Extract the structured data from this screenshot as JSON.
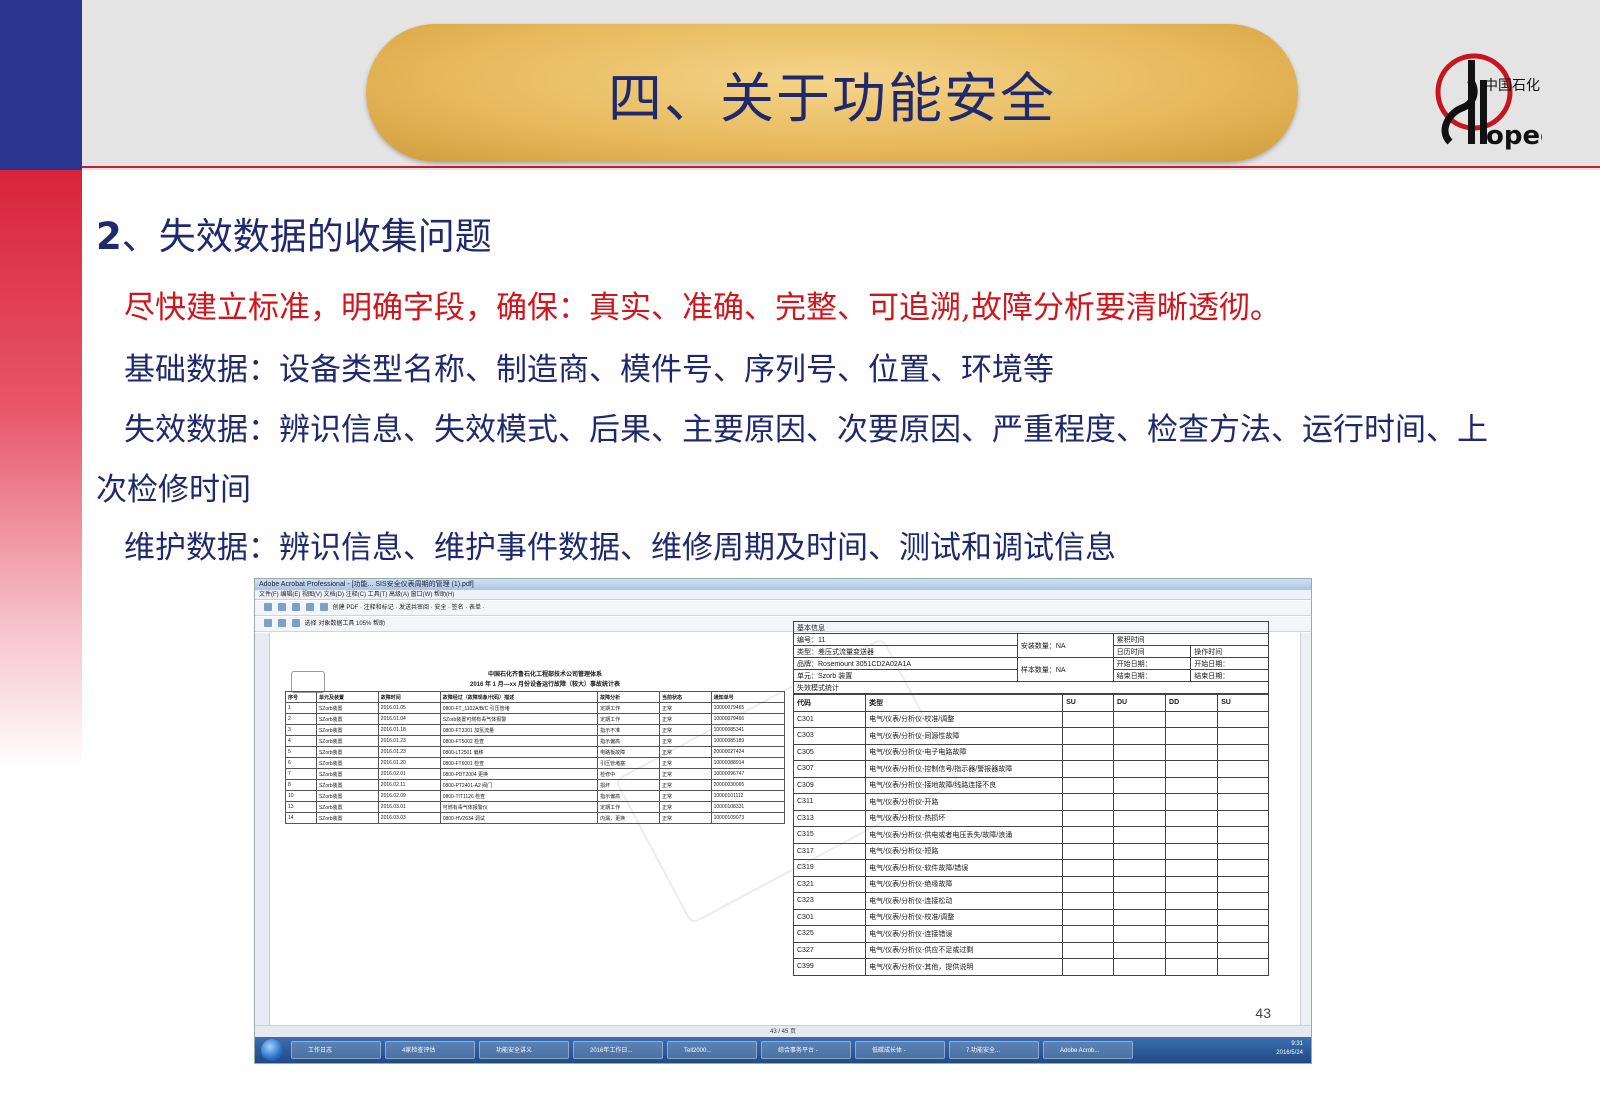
{
  "slide": {
    "title": "四、关于功能安全",
    "section_number": "2",
    "section_title": "、失效数据的收集问题",
    "requirement": "尽快建立标准，明确字段，确保：真实、准确、完整、可追溯,故障分析要清晰透彻。",
    "basic_data": "基础数据：设备类型名称、制造商、模件号、序列号、位置、环境等",
    "failure_data_line1": "失效数据：辨识信息、失效模式、后果、主要原因、次要原因、严重程度、检查方法、运行时间、上",
    "failure_data_line2": "次检修时间",
    "maintenance_data": "维护数据：辨识信息、维护事件数据、维修周期及时间、测试和调试信息",
    "colors": {
      "navy": "#2b3690",
      "red": "#d8243a",
      "gold": "#e6b85a",
      "text_blue": "#1f2a6e",
      "text_red": "#d0161c"
    }
  },
  "logo": {
    "brand": "SINOPEC",
    "chinese": "中国石化",
    "icon": "sinopec-logo"
  },
  "screenshot": {
    "window_title": "Adobe Acrobat Professional - [功能... SIS安全仪表周期的管理 (1).pdf]",
    "menu": "文件(F)  编辑(E)  视图(V)  文档(D)  注释(C)  工具(T)  高级(A)  窗口(W)  帮助(H)",
    "toolbar1": "创建 PDF ·  注释和标记 ·  发送共审阅 ·  安全 ·  签名 ·  表单 ·",
    "toolbar2": "选择  对象数据工具  105%  帮助",
    "status": "43 / 45 页",
    "page_number": "43",
    "taskbar": [
      "工作日志",
      "4家检查评估",
      "功能安全讲义",
      "2016年工作日...",
      "Tell2000...",
      "综合事务平台 -",
      "低碳成长体 -",
      "7.功能安全...",
      "Adobe Acrob..."
    ],
    "clock_time": "9:31",
    "clock_date": "2016/5/24",
    "report": {
      "title1": "中国石化齐鲁石化工程部技术公司管理体系",
      "title2": "2016 年 1 月—xx 月份设备运行故障（较大）事故统计表",
      "header": [
        "序号",
        "单元及装置",
        "故障时间",
        "故障经过（故障现象/代码）描述",
        "故障分析",
        "当前状态",
        "通知单号"
      ],
      "rows": [
        [
          "1",
          "SZorb装置",
          "2016.01.05",
          "0800-FT_1102A/B/C 引压管堵",
          "定期工作",
          "正常",
          "10000079465"
        ],
        [
          "2",
          "SZorb装置",
          "2016.01.04",
          "SZorb装置可燃有毒气体报警",
          "定期工作",
          "正常",
          "10000079466"
        ],
        [
          "3",
          "SZorb装置",
          "2016.01.18",
          "0800-FT3301 加氢流量",
          "指示不准",
          "正常",
          "10000085341"
        ],
        [
          "4",
          "SZorb装置",
          "2016.01.23",
          "0800-FT5002 检查",
          "指示偏高",
          "正常",
          "10000085189"
        ],
        [
          "5",
          "SZorb装置",
          "2016.01.23",
          "0800-LT2501 偏移",
          "电路板故障",
          "正常",
          "20000027424"
        ],
        [
          "6",
          "SZorb装置",
          "2016.01.20",
          "0800-FT6001 检查",
          "引压管堵塞",
          "正常",
          "10000088914"
        ],
        [
          "7",
          "SZorb装置",
          "2016.02.01",
          "0800-PDT2004 更换",
          "检修中",
          "正常",
          "10000096747"
        ],
        [
          "8",
          "SZorb装置",
          "2016.02.11",
          "0800-PT2401-A2 阀门",
          "损坏",
          "正常",
          "20000030065"
        ],
        [
          "10",
          "SZorb装置",
          "2016.02.09",
          "0800-TIT1126 检查",
          "指示偏高",
          "正常",
          "10000101112"
        ],
        [
          "13",
          "SZorb装置",
          "2016.03.01",
          "可燃有毒气体报警仪",
          "定期工作",
          "正常",
          "10000108331"
        ],
        [
          "14",
          "SZorb装置",
          "2016.03.03",
          "0800-HV2634 调试",
          "内漏，更换",
          "正常",
          "10000109073"
        ]
      ]
    },
    "form": {
      "basic_info": "基本信息",
      "id": "编号：11",
      "type": "类型：差压式流量变送器",
      "brand": "品牌：Rosemount 3051CD2A02A1A",
      "unit": "单元：Szorb 装置",
      "install_count": "安装数量：NA",
      "sample_count": "样本数量：NA",
      "cumulative_time": "累积时间",
      "calendar_time": "日历时间",
      "operating_time": "操作时间",
      "start_date": "开始日期：",
      "end_date": "结束日期：",
      "failure_stats": "失效模式统计",
      "columns": [
        "代码",
        "类型",
        "SU",
        "DU",
        "DD",
        "SU"
      ],
      "modes": [
        [
          "C301",
          "电气/仪表/分析仪-校准/调整"
        ],
        [
          "C303",
          "电气/仪表/分析仪-同源性故障"
        ],
        [
          "C305",
          "电气/仪表/分析仪-电子电路故障"
        ],
        [
          "C307",
          "电气/仪表/分析仪-控制信号/指示器/警报器故障"
        ],
        [
          "C309",
          "电气/仪表/分析仪-接地故障/线路连接不良"
        ],
        [
          "C311",
          "电气/仪表/分析仪-开路"
        ],
        [
          "C313",
          "电气/仪表/分析仪-热损坏"
        ],
        [
          "C315",
          "电气/仪表/分析仪-供电或者电压丢失/故障/浪涌"
        ],
        [
          "C317",
          "电气/仪表/分析仪-短路"
        ],
        [
          "C319",
          "电气/仪表/分析仪-软件故障/错误"
        ],
        [
          "C321",
          "电气/仪表/分析仪-绝缘故障"
        ],
        [
          "C323",
          "电气/仪表/分析仪-连接松动"
        ],
        [
          "C301",
          "电气/仪表/分析仪-校准/调整"
        ],
        [
          "C325",
          "电气/仪表/分析仪-连接错误"
        ],
        [
          "C327",
          "电气/仪表/分析仪-供应不足或过剩"
        ],
        [
          "C399",
          "电气/仪表/分析仪-其他，提供说明"
        ]
      ]
    }
  }
}
